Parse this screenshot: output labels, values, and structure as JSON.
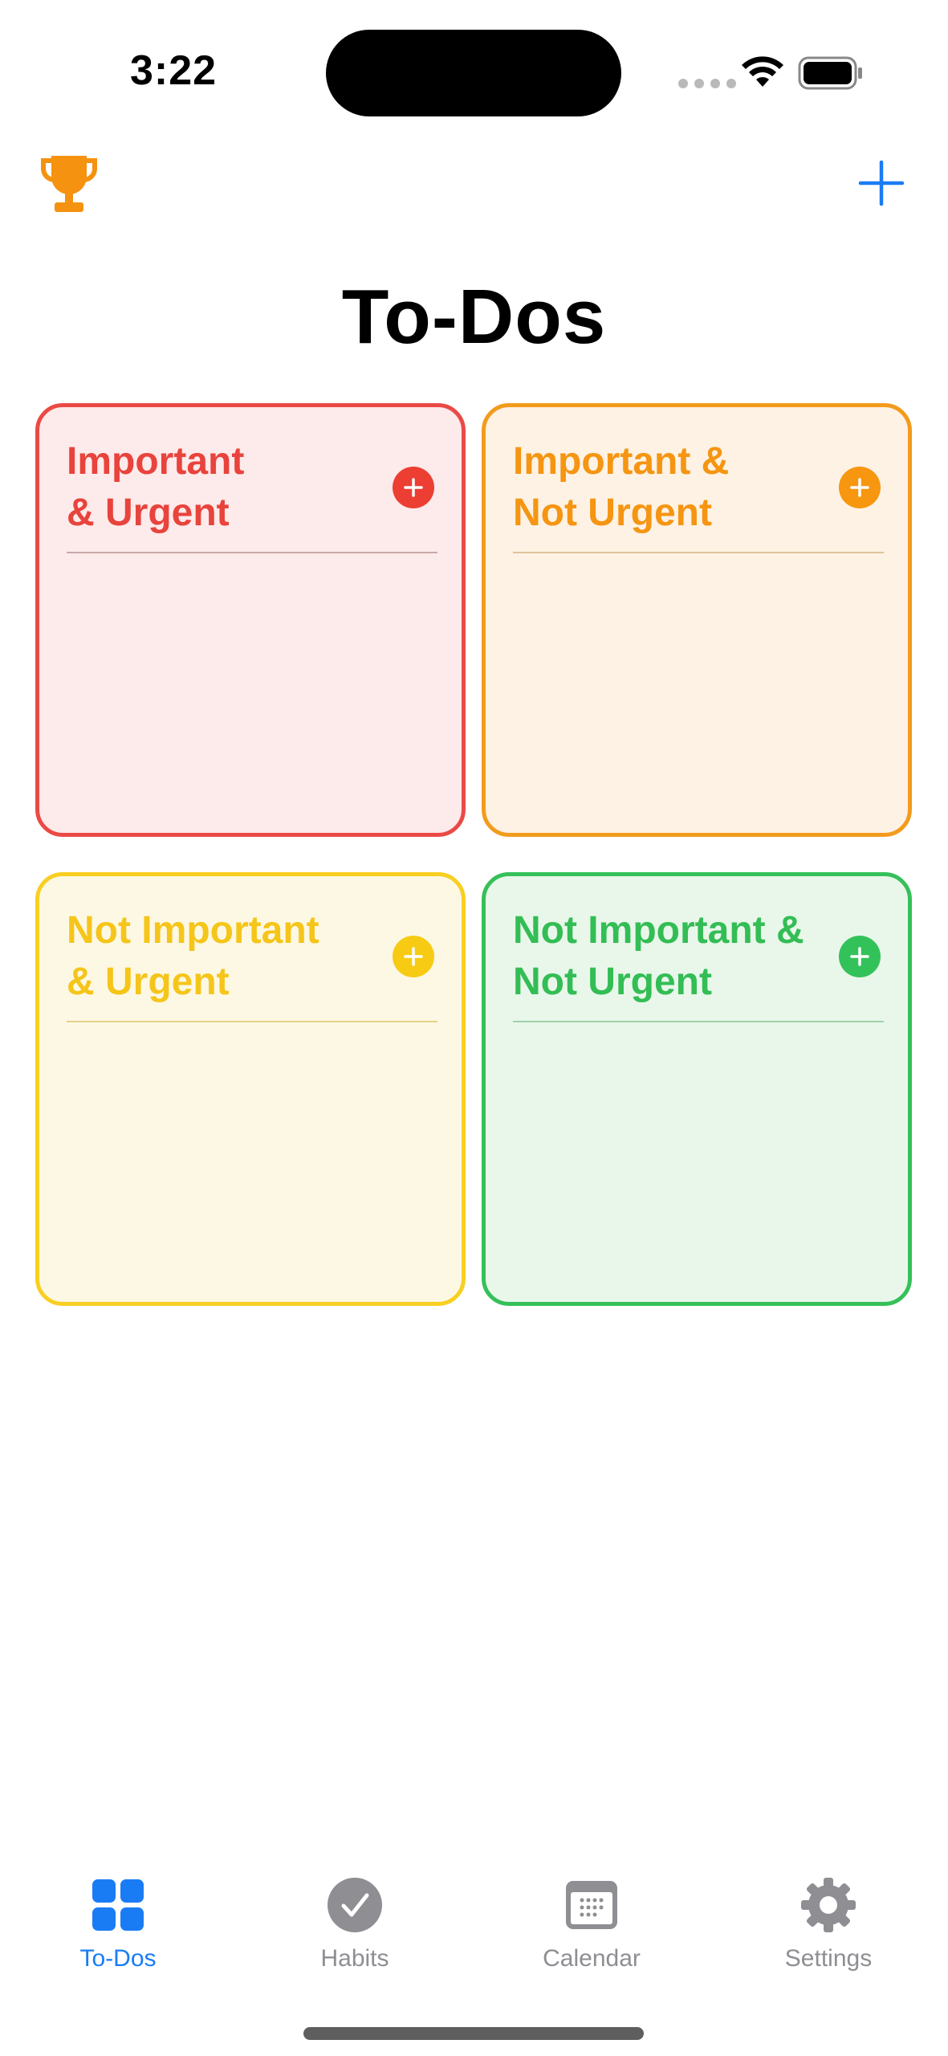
{
  "status_bar": {
    "time": "3:22"
  },
  "header": {
    "title": "To-Dos",
    "trophy_icon": "trophy-icon",
    "add_icon": "plus-icon"
  },
  "quadrants": [
    {
      "line1": "Important",
      "line2": "& Urgent",
      "color": "#e8433c",
      "background": "#fdeaea"
    },
    {
      "line1": "Important &",
      "line2": "Not Urgent",
      "color": "#f59512",
      "background": "#fdf2e4"
    },
    {
      "line1": "Not Important",
      "line2": "& Urgent",
      "color": "#f5c519",
      "background": "#fdf8e4"
    },
    {
      "line1": "Not Important &",
      "line2": "Not Urgent",
      "color": "#33bd55",
      "background": "#e9f7ea"
    }
  ],
  "tab_bar": {
    "active_color": "#1a7cf5",
    "inactive_color": "#8e8e93",
    "tabs": [
      {
        "label": "To-Dos",
        "icon": "grid-icon",
        "active": true
      },
      {
        "label": "Habits",
        "icon": "checkmark-circle-icon",
        "active": false
      },
      {
        "label": "Calendar",
        "icon": "calendar-icon",
        "active": false
      },
      {
        "label": "Settings",
        "icon": "gear-icon",
        "active": false
      }
    ]
  }
}
